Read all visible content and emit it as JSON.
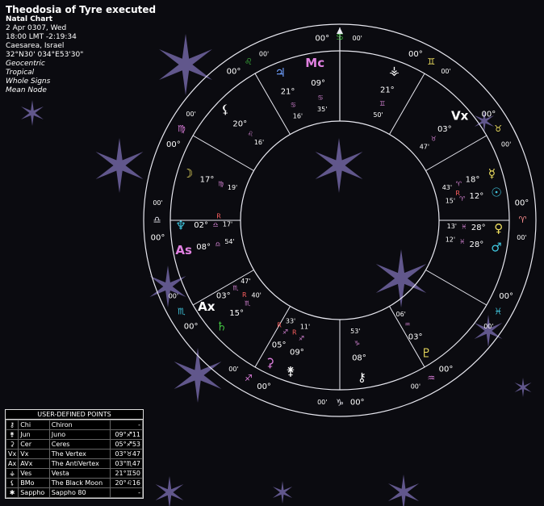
{
  "header": {
    "title": "Theodosia of Tyre executed",
    "chart_type": "Natal Chart",
    "date_line": "2 Apr 0307, Wed",
    "time_line": "18:00  LMT  -2:19:34",
    "place_line": "Caesarea, Israel",
    "coords_line": "32°N30'  034°E53'30\"",
    "options": [
      "Geocentric",
      "Tropical",
      "Whole Signs",
      "Mean Node"
    ]
  },
  "colors": {
    "background": "#0b0b10",
    "star": "#6a5f9a",
    "ring": "#e8e8f0",
    "sign_aries": "#ff9090",
    "planet_yellow": "#f0e060",
    "planet_cyan": "#40c8e0",
    "planet_green": "#40c040",
    "planet_pink": "#e080e0",
    "retro_red": "#ff6060"
  },
  "wheel": {
    "house_cusps": [
      {
        "sign": "♋",
        "deg": "00°",
        "min": "00'"
      },
      {
        "sign": "♌",
        "deg": "00°",
        "min": "00'"
      },
      {
        "sign": "♍",
        "deg": "00°",
        "min": "00'"
      },
      {
        "sign": "♎",
        "deg": "00°",
        "min": "00'"
      },
      {
        "sign": "♏",
        "deg": "00°",
        "min": "00'"
      },
      {
        "sign": "♐",
        "deg": "00°",
        "min": "00'"
      },
      {
        "sign": "♑",
        "deg": "00°",
        "min": "00'"
      },
      {
        "sign": "♒",
        "deg": "00°",
        "min": "00'"
      },
      {
        "sign": "♓",
        "deg": "00°",
        "min": "00'"
      },
      {
        "sign": "♈",
        "deg": "00°",
        "min": "00'"
      },
      {
        "sign": "♉",
        "deg": "00°",
        "min": "00'"
      },
      {
        "sign": "♊",
        "deg": "00°",
        "min": "00'"
      }
    ],
    "points": [
      {
        "name": "jupiter",
        "glyph": "♃",
        "deg": "21°",
        "sign": "♋",
        "min": "16'",
        "retro": ""
      },
      {
        "name": "midheaven",
        "glyph": "Mc",
        "deg": "09°",
        "sign": "♋",
        "min": "35'",
        "retro": ""
      },
      {
        "name": "vesta",
        "glyph": "⚶",
        "deg": "21°",
        "sign": "♊",
        "min": "50'",
        "retro": ""
      },
      {
        "name": "vertex",
        "glyph": "Vx",
        "deg": "03°",
        "sign": "♉",
        "min": "47'",
        "retro": ""
      },
      {
        "name": "black-moon",
        "glyph": "⚸",
        "deg": "20°",
        "sign": "♌",
        "min": "16'",
        "retro": ""
      },
      {
        "name": "moon",
        "glyph": "☽",
        "deg": "17°",
        "sign": "♍",
        "min": "19'",
        "retro": ""
      },
      {
        "name": "mercury",
        "glyph": "☿",
        "deg": "18°",
        "sign": "♈",
        "min": "43'",
        "retro": "R"
      },
      {
        "name": "sun",
        "glyph": "☉",
        "deg": "12°",
        "sign": "♈",
        "min": "15'",
        "retro": ""
      },
      {
        "name": "neptune",
        "glyph": "♆",
        "deg": "02°",
        "sign": "♎",
        "min": "17'",
        "retro": "R"
      },
      {
        "name": "ascendant",
        "glyph": "As",
        "deg": "08°",
        "sign": "♎",
        "min": "54'",
        "retro": ""
      },
      {
        "name": "venus",
        "glyph": "♀",
        "deg": "28°",
        "sign": "♓",
        "min": "13'",
        "retro": ""
      },
      {
        "name": "mars",
        "glyph": "♂",
        "deg": "28°",
        "sign": "♓",
        "min": "12'",
        "retro": ""
      },
      {
        "name": "antivertex",
        "glyph": "Ax",
        "deg": "03°",
        "sign": "♏",
        "min": "47'",
        "retro": ""
      },
      {
        "name": "saturn",
        "glyph": "♄",
        "deg": "15°",
        "sign": "♏",
        "min": "40'",
        "retro": "R"
      },
      {
        "name": "juno",
        "glyph": "⚵",
        "deg": "09°",
        "sign": "♐",
        "min": "11'",
        "retro": "R"
      },
      {
        "name": "ceres",
        "glyph": "⚳",
        "deg": "05°",
        "sign": "♐",
        "min": "33'",
        "retro": "R"
      },
      {
        "name": "chiron",
        "glyph": "⚷",
        "deg": "08°",
        "sign": "♑",
        "min": "53'",
        "retro": ""
      },
      {
        "name": "pluto",
        "glyph": "♇",
        "deg": "03°",
        "sign": "♒",
        "min": "06'",
        "retro": ""
      }
    ]
  },
  "udp": {
    "caption": "USER-DEFINED POINTS",
    "rows": [
      {
        "glyph": "⚷",
        "abbr": "Chi",
        "name": "Chiron",
        "value": "-"
      },
      {
        "glyph": "⚵",
        "abbr": "Jun",
        "name": "Juno",
        "value": "09°♐11"
      },
      {
        "glyph": "⚳",
        "abbr": "Cer",
        "name": "Ceres",
        "value": "05°♐53"
      },
      {
        "glyph": "Vx",
        "abbr": "Vx",
        "name": "The Vertex",
        "value": "03°♉47"
      },
      {
        "glyph": "Ax",
        "abbr": "AVx",
        "name": "The AntiVertex",
        "value": "03°♏47"
      },
      {
        "glyph": "⚶",
        "abbr": "Ves",
        "name": "Vesta",
        "value": "21°♊50"
      },
      {
        "glyph": "⚸",
        "abbr": "BMo",
        "name": "The Black Moon",
        "value": "20°♌16"
      },
      {
        "glyph": "✱",
        "abbr": "Sappho",
        "name": "Sappho 80",
        "value": "-"
      }
    ]
  }
}
